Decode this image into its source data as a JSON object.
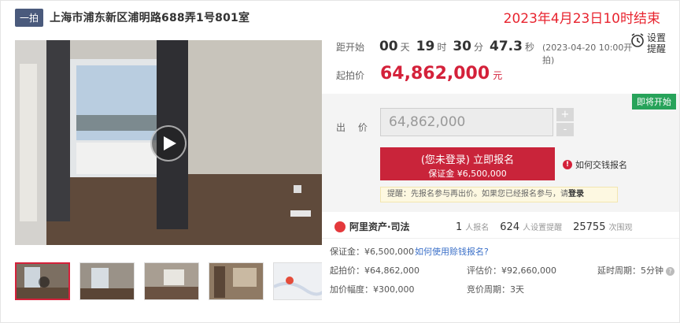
{
  "header": {
    "tag": "一拍",
    "title": "上海市浦东新区浦明路688弄1号801室",
    "deadline": "2023年4月23日10时结束"
  },
  "countdown": {
    "label": "距开始",
    "days": "00",
    "days_unit": "天",
    "hours": "19",
    "hours_unit": "时",
    "minutes": "30",
    "minutes_unit": "分",
    "seconds": "47.3",
    "seconds_unit": "秒",
    "start_note": "(2023-04-20 10:00开拍)"
  },
  "remind": {
    "line1": "设置",
    "line2": "提醒",
    "icon": "alarm-clock-icon"
  },
  "start_price": {
    "label": "起拍价",
    "value": "64,862,000",
    "unit": "元"
  },
  "bid": {
    "badge": "即将开始",
    "label": "出 价",
    "input_value": "64,862,000",
    "plus": "+",
    "minus": "-",
    "apply_line1": "(您未登录) 立即报名",
    "apply_line2": "保证金 ¥6,500,000",
    "how_pay": "如何交钱报名",
    "tip_prefix": "提醒：先报名参与再出价。如果您已经报名参与，请",
    "tip_link": "登录"
  },
  "stats": {
    "brand": "阿里资产·司法",
    "signups": "1",
    "signups_label": "人报名",
    "reminders": "624",
    "reminders_label": "人设置提醒",
    "views": "25755",
    "views_label": "次围观"
  },
  "details": {
    "deposit": "保证金：¥6,500,000",
    "deposit_link": "如何使用赊钱报名?",
    "start_price": "起拍价：¥64,862,000",
    "valuation": "评估价：¥92,660,000",
    "delay": "延时周期：5分钟",
    "increment": "加价幅度：¥300,000",
    "cycle": "竞价周期：3天"
  },
  "colors": {
    "accent": "#d4213a",
    "badge": "#27a35a",
    "tag": "#4a5a7c"
  }
}
